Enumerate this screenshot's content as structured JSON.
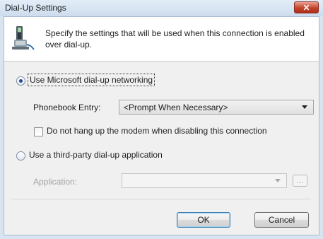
{
  "window": {
    "title": "Dial-Up Settings",
    "close_glyph": "✕"
  },
  "header": {
    "description": "Specify the settings that will be used when this connection is enabled over dial-up."
  },
  "options": {
    "microsoft": {
      "label": "Use Microsoft dial-up networking",
      "accel_index": 4,
      "selected": true
    },
    "phonebook": {
      "label": "Phonebook Entry:",
      "value": "<Prompt When Necessary>"
    },
    "hangup": {
      "label": "Do not hang up the modem when disabling this connection",
      "checked": false
    },
    "third_party": {
      "label": "Use a third-party dial-up application",
      "selected": false
    },
    "application": {
      "label": "Application:",
      "value": "",
      "browse_label": "..."
    }
  },
  "buttons": {
    "ok": "OK",
    "cancel": "Cancel"
  },
  "colors": {
    "titlebar": "#cddcee",
    "close_button": "#c4442c",
    "dialog_bg": "#f0f0f0",
    "default_button_border": "#3c7fb1"
  }
}
